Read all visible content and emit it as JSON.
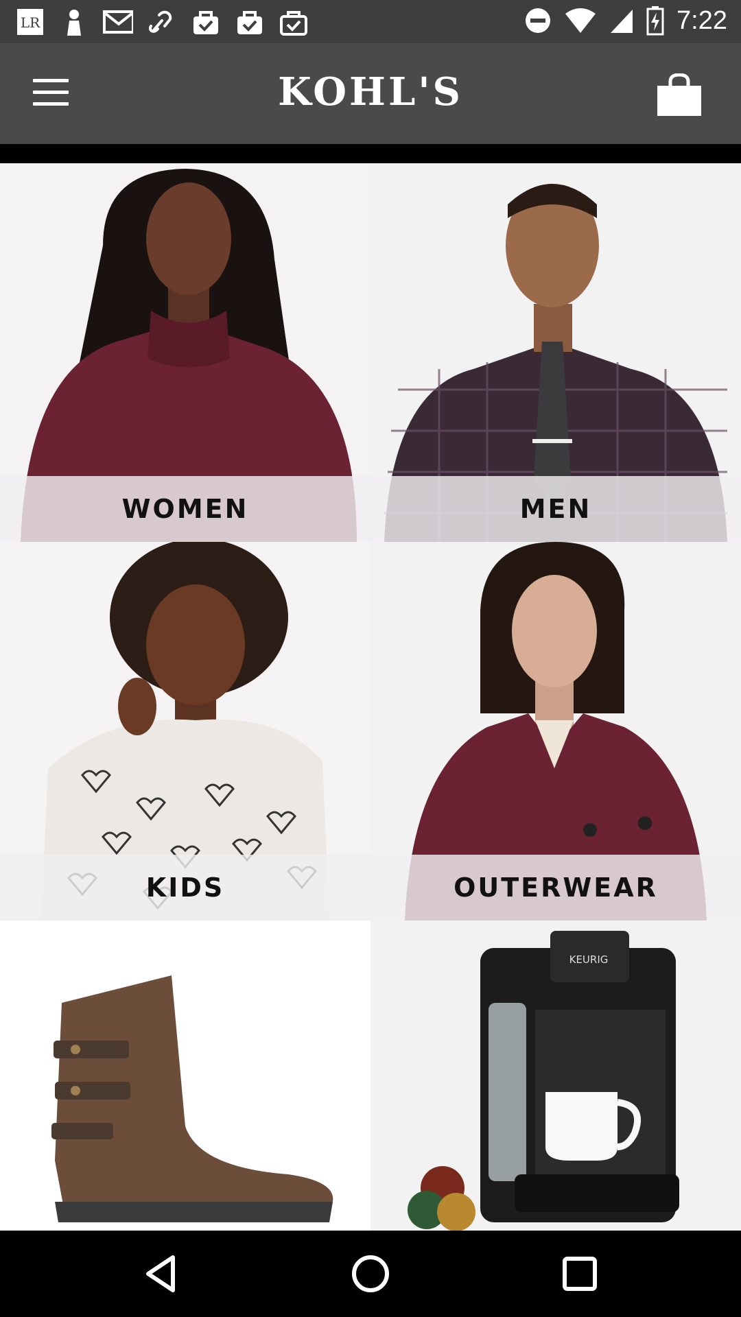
{
  "status_bar": {
    "time": "7:22",
    "left_icons": [
      "lr-icon",
      "person-icon",
      "mail-icon",
      "link-icon",
      "shopping-bag-check-icon",
      "shopping-bag-check-icon",
      "shopping-bag-check-icon"
    ],
    "right_icons": [
      "do-not-disturb-icon",
      "wifi-icon",
      "signal-icon",
      "battery-charging-icon"
    ]
  },
  "header": {
    "logo": "KOHL'S"
  },
  "categories": [
    {
      "label": "WOMEN",
      "image": "woman-burgundy-turtleneck"
    },
    {
      "label": "MEN",
      "image": "man-plaid-shirt-tie"
    },
    {
      "label": "KIDS",
      "image": "kid-heart-print-top"
    },
    {
      "label": "OUTERWEAR",
      "image": "woman-burgundy-peacoat"
    },
    {
      "label": "",
      "image": "brown-ankle-boot"
    },
    {
      "label": "",
      "image": "keurig-coffee-maker",
      "brand_text": "KEURIG"
    }
  ],
  "colors": {
    "status_bar": "#3e3e3e",
    "app_bar": "#4a4a4a",
    "burgundy": "#6b2232"
  }
}
